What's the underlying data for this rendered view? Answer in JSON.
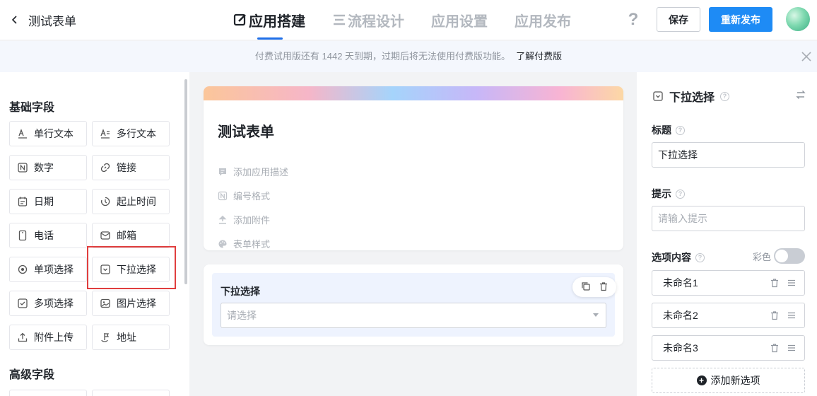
{
  "header": {
    "back_label": "测试表单",
    "tabs": [
      {
        "label": "应用搭建",
        "icon": "edit-icon",
        "active": true
      },
      {
        "label": "流程设计",
        "icon": "list-icon",
        "active": false
      },
      {
        "label": "应用设置",
        "active": false
      },
      {
        "label": "应用发布",
        "active": false
      }
    ],
    "help": "?",
    "save_label": "保存",
    "publish_label": "重新发布"
  },
  "notice": {
    "text": "付费试用版还有 1442 天到期，过期后将无法使用付费版功能。",
    "link": "了解付费版"
  },
  "palette": {
    "basic_title": "基础字段",
    "advanced_title": "高级字段",
    "fields": [
      {
        "label": "单行文本",
        "icon": "single-line-text-icon"
      },
      {
        "label": "多行文本",
        "icon": "multi-line-text-icon"
      },
      {
        "label": "数字",
        "icon": "number-icon"
      },
      {
        "label": "链接",
        "icon": "link-icon"
      },
      {
        "label": "日期",
        "icon": "calendar-icon"
      },
      {
        "label": "起止时间",
        "icon": "time-range-icon"
      },
      {
        "label": "电话",
        "icon": "phone-icon"
      },
      {
        "label": "邮箱",
        "icon": "mail-icon"
      },
      {
        "label": "单项选择",
        "icon": "radio-icon"
      },
      {
        "label": "下拉选择",
        "icon": "dropdown-icon"
      },
      {
        "label": "多项选择",
        "icon": "checkbox-icon"
      },
      {
        "label": "图片选择",
        "icon": "image-icon"
      },
      {
        "label": "附件上传",
        "icon": "upload-icon"
      },
      {
        "label": "地址",
        "icon": "location-icon"
      }
    ]
  },
  "form": {
    "title": "测试表单",
    "meta": [
      {
        "label": "添加应用描述",
        "icon": "comment-icon"
      },
      {
        "label": "编号格式",
        "icon": "number-icon"
      },
      {
        "label": "添加附件",
        "icon": "upload-icon"
      },
      {
        "label": "表单样式",
        "icon": "palette-icon"
      }
    ],
    "field": {
      "label": "下拉选择",
      "placeholder": "请选择"
    }
  },
  "props": {
    "field_type": "下拉选择",
    "title_label": "标题",
    "title_value": "下拉选择",
    "hint_label": "提示",
    "hint_placeholder": "请输入提示",
    "options_label": "选项内容",
    "color_label": "彩色",
    "color_enabled": false,
    "options": [
      "未命名1",
      "未命名2",
      "未命名3"
    ],
    "add_option_label": "添加新选项"
  },
  "colors": {
    "accent": "#1e8bf5",
    "highlight": "#e03e3e",
    "field_bg": "#eef3fe"
  }
}
